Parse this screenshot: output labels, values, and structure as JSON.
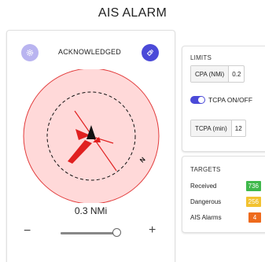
{
  "page": {
    "title": "AIS ALARM"
  },
  "radar": {
    "status": "ACKNOWLEDGED",
    "range_text": "0.3 NMi",
    "north_label": "N",
    "zoom_minus": "−",
    "zoom_plus": "+",
    "zoom_level": 0.95,
    "colors": {
      "alarm_zone": "#ffd9d9",
      "alarm_border": "#e23b3b",
      "target": "#e02020",
      "own_ship": "#111111"
    }
  },
  "limits": {
    "heading": "LIMITS",
    "cpa_label": "CPA (NMi)",
    "cpa_value": "0.2",
    "tcpa_toggle_label": "TCPA ON/OFF",
    "tcpa_enabled": true,
    "tcpa_label": "TCPA (min)",
    "tcpa_value": "12"
  },
  "targets": {
    "heading": "TARGETS",
    "rows": [
      {
        "label": "Received",
        "value": "736",
        "color": "#3fb84b"
      },
      {
        "label": "Dangerous",
        "value": "256",
        "color": "#f2c230"
      },
      {
        "label": "AIS Alarms",
        "value": "4",
        "color": "#ee6a1c"
      }
    ]
  },
  "icons": {
    "settings": "gear-icon",
    "locate": "satellite-dish-icon"
  }
}
